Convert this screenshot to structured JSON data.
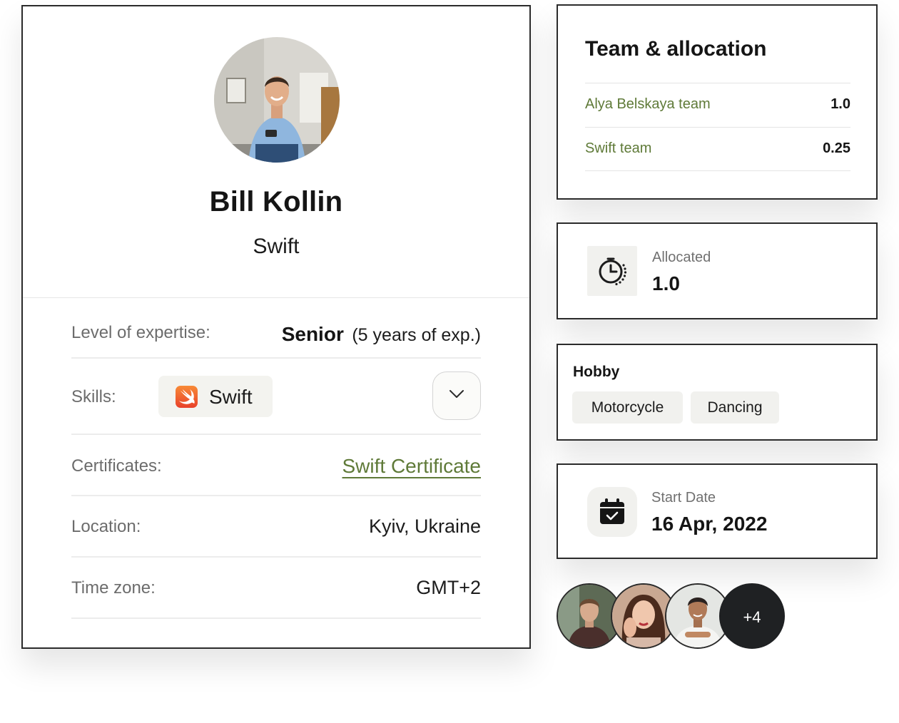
{
  "profile": {
    "name": "Bill Kollin",
    "role": "Swift",
    "avatar": "profile-photo-man",
    "details": {
      "expertise_label": "Level of expertise:",
      "expertise_level": "Senior",
      "expertise_note": "(5 years of exp.)",
      "skills_label": "Skills:",
      "skill_chip": "Swift",
      "skill_icon": "swift-logo-icon",
      "dropdown_icon": "chevron-down-icon",
      "certificates_label": "Certificates:",
      "certificate_link": "Swift Certificate",
      "location_label": "Location:",
      "location_value": "Kyiv, Ukraine",
      "timezone_label": "Time zone:",
      "timezone_value": "GMT+2"
    }
  },
  "team_allocation": {
    "title": "Team & allocation",
    "rows": [
      {
        "name": "Alya Belskaya team",
        "value": "1.0"
      },
      {
        "name": "Swift team",
        "value": "0.25"
      }
    ]
  },
  "allocated": {
    "icon": "timer-icon",
    "label": "Allocated",
    "value": "1.0"
  },
  "hobby": {
    "title": "Hobby",
    "chips": [
      "Motorcycle",
      "Dancing"
    ]
  },
  "start_date": {
    "icon": "calendar-check-icon",
    "label": "Start Date",
    "value": "16 Apr, 2022"
  },
  "team_members": {
    "more_count": "+4"
  },
  "colors": {
    "accent_green": "#5f7a38",
    "border_dark": "#2b2b2b",
    "chip_bg": "#f1f1ee",
    "more_badge_bg": "#1f2123"
  }
}
